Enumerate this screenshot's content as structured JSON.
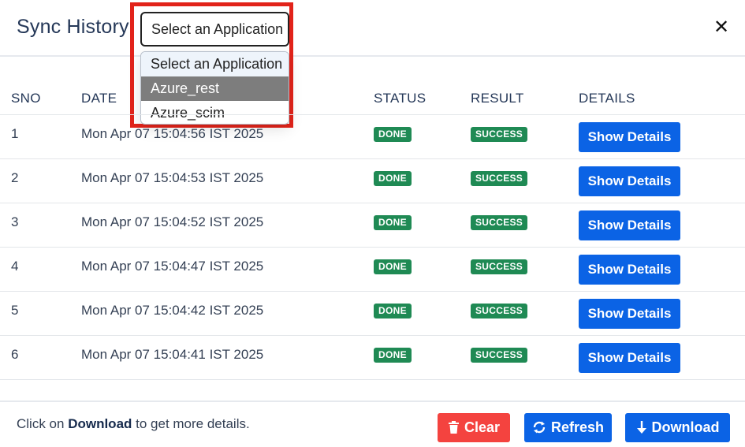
{
  "header": {
    "title": "Sync History",
    "close_glyph": "✕"
  },
  "app_select": {
    "value": "Select an Application",
    "options": [
      "Select an Application",
      "Azure_rest",
      "Azure_scim"
    ],
    "highlighted_option": "Azure_rest"
  },
  "table": {
    "columns": [
      "SNO",
      "DATE",
      "STATUS",
      "RESULT",
      "DETAILS"
    ],
    "rows": [
      {
        "sno": "1",
        "date": "Mon Apr 07 15:04:56 IST 2025",
        "status": "DONE",
        "result": "SUCCESS",
        "details": "Show Details"
      },
      {
        "sno": "2",
        "date": "Mon Apr 07 15:04:53 IST 2025",
        "status": "DONE",
        "result": "SUCCESS",
        "details": "Show Details"
      },
      {
        "sno": "3",
        "date": "Mon Apr 07 15:04:52 IST 2025",
        "status": "DONE",
        "result": "SUCCESS",
        "details": "Show Details"
      },
      {
        "sno": "4",
        "date": "Mon Apr 07 15:04:47 IST 2025",
        "status": "DONE",
        "result": "SUCCESS",
        "details": "Show Details"
      },
      {
        "sno": "5",
        "date": "Mon Apr 07 15:04:42 IST 2025",
        "status": "DONE",
        "result": "SUCCESS",
        "details": "Show Details"
      },
      {
        "sno": "6",
        "date": "Mon Apr 07 15:04:41 IST 2025",
        "status": "DONE",
        "result": "SUCCESS",
        "details": "Show Details"
      }
    ]
  },
  "footer": {
    "note_prefix": "Click on ",
    "note_bold": "Download",
    "note_suffix": " to get more details.",
    "clear_label": "Clear",
    "refresh_label": "Refresh",
    "download_label": "Download",
    "icons": {
      "clear": "trash-icon",
      "refresh": "refresh-icon",
      "download": "arrow-down-icon"
    }
  },
  "colors": {
    "primary": "#0b63e5",
    "danger": "#f4433f",
    "success_badge": "#1f8a54",
    "highlight_border": "#e2231a"
  }
}
